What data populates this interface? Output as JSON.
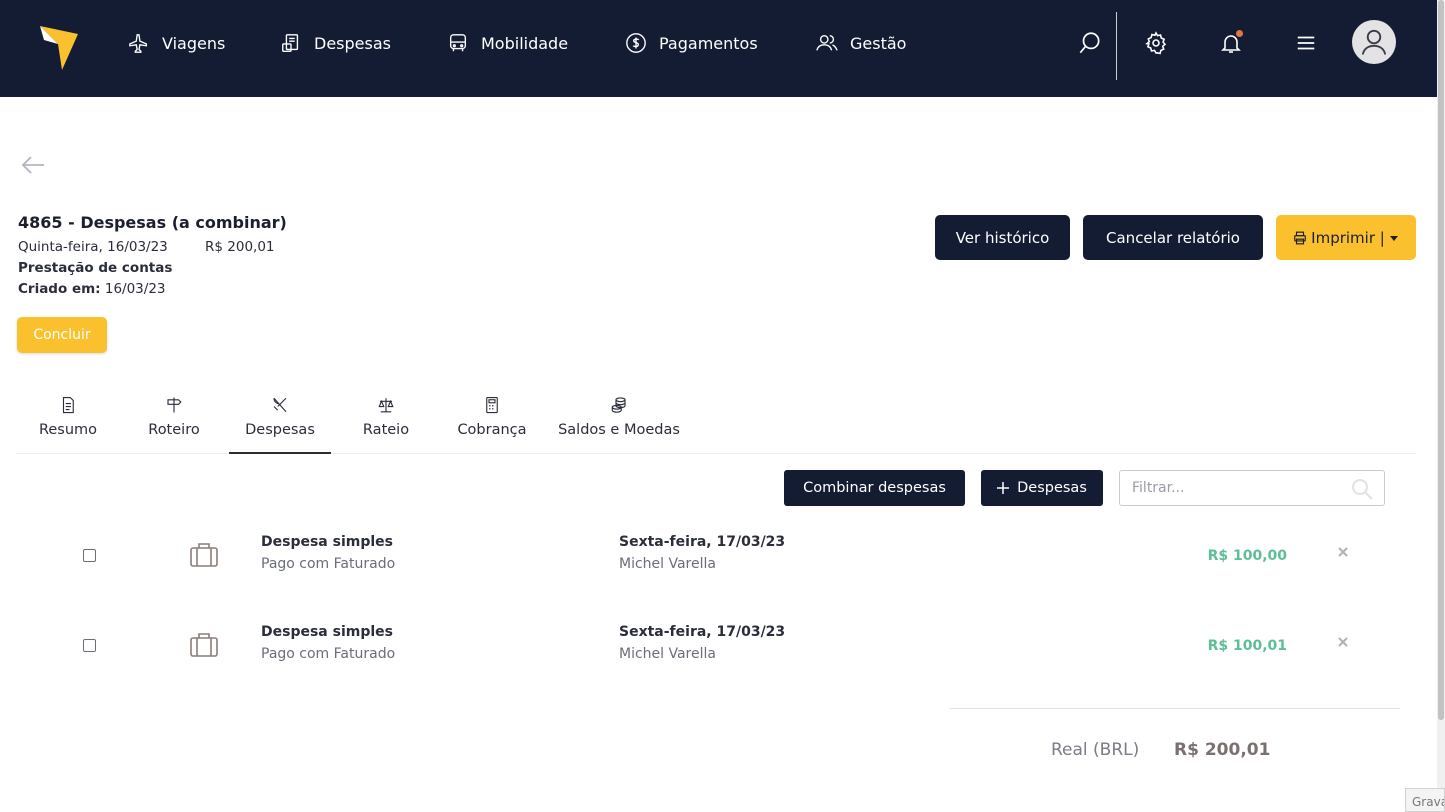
{
  "nav": {
    "items": [
      {
        "label": "Viagens",
        "icon": "airplane-icon"
      },
      {
        "label": "Despesas",
        "icon": "receipt-icon"
      },
      {
        "label": "Mobilidade",
        "icon": "bus-icon"
      },
      {
        "label": "Pagamentos",
        "icon": "dollar-circle-icon"
      },
      {
        "label": "Gestão",
        "icon": "users-icon"
      }
    ],
    "right_icons": [
      "search-icon",
      "gear-icon",
      "bell-icon",
      "hamburger-icon",
      "avatar-icon"
    ]
  },
  "colors": {
    "nav_bg": "#141c33",
    "accent_yellow": "#fbc02d",
    "amount_green": "#5cbf95"
  },
  "report": {
    "title": "4865 - Despesas (a combinar)",
    "date": "Quinta-feira, 16/03/23",
    "amount": "R$ 200,01",
    "type": "Prestação de contas",
    "created_label": "Criado em:",
    "created_value": "16/03/23"
  },
  "actions": {
    "history": "Ver histórico",
    "cancel": "Cancelar relatório",
    "print": "Imprimir |",
    "conclude": "Concluir"
  },
  "tabs": [
    {
      "label": "Resumo",
      "icon": "document-icon"
    },
    {
      "label": "Roteiro",
      "icon": "signpost-icon"
    },
    {
      "label": "Despesas",
      "icon": "utensils-icon",
      "active": true
    },
    {
      "label": "Rateio",
      "icon": "scale-icon"
    },
    {
      "label": "Cobrança",
      "icon": "calculator-icon"
    },
    {
      "label": "Saldos e Moedas",
      "icon": "coins-icon"
    }
  ],
  "toolbar": {
    "combine": "Combinar despesas",
    "add_expense": "Despesas",
    "filter_placeholder": "Filtrar..."
  },
  "expenses": [
    {
      "title": "Despesa simples",
      "payment": "Pago com Faturado",
      "date": "Sexta-feira, 17/03/23",
      "user": "Michel Varella",
      "amount": "R$ 100,00",
      "icon": "suitcase-icon"
    },
    {
      "title": "Despesa simples",
      "payment": "Pago com Faturado",
      "date": "Sexta-feira, 17/03/23",
      "user": "Michel Varella",
      "amount": "R$ 100,01",
      "icon": "suitcase-icon"
    }
  ],
  "total": {
    "currency_label": "Real (BRL)",
    "value": "R$ 200,01"
  },
  "corner_tag": "Grava"
}
